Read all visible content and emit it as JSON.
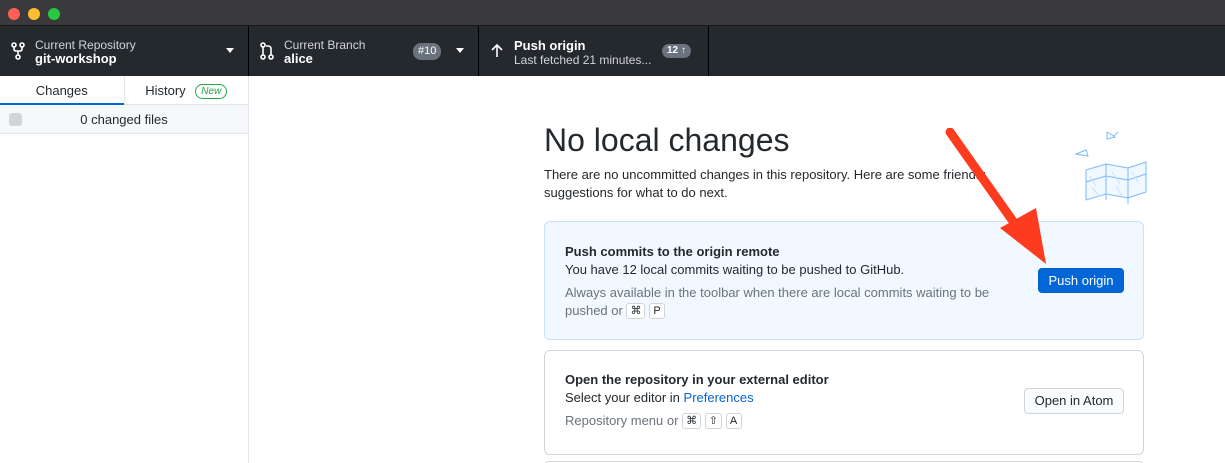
{
  "toolbar": {
    "repository": {
      "label": "Current Repository",
      "value": "git-workshop"
    },
    "branch": {
      "label": "Current Branch",
      "value": "alice",
      "pr_badge": "#10"
    },
    "push": {
      "label": "Push origin",
      "sublabel": "Last fetched 21 minutes...",
      "badge_count": "12",
      "badge_arrow": "↑"
    }
  },
  "sidebar": {
    "tabs": [
      {
        "label": "Changes",
        "active": true
      },
      {
        "label": "History",
        "badge": "New"
      }
    ],
    "changed_files": "0 changed files"
  },
  "main": {
    "title": "No local changes",
    "description": "There are no uncommitted changes in this repository. Here are some friendly suggestions for what to do next.",
    "push_card": {
      "title": "Push commits to the origin remote",
      "text": "You have 12 local commits waiting to be pushed to GitHub.",
      "hint": "Always available in the toolbar when there are local commits waiting to be pushed or",
      "shortcut": [
        "⌘",
        "P"
      ],
      "button": "Push origin"
    },
    "editor_card": {
      "title": "Open the repository in your external editor",
      "text_prefix": "Select your editor in",
      "link": "Preferences",
      "hint": "Repository menu or",
      "shortcut": [
        "⌘",
        "⇧",
        "A"
      ],
      "button": "Open in Atom"
    }
  },
  "colors": {
    "accent": "#0366d6",
    "toolbar_bg": "#24292e",
    "annotation_arrow": "#ff3b1f",
    "new_badge": "#28a745"
  },
  "icons": {
    "repository": "repo-fork-icon",
    "branch": "git-branch-icon",
    "push": "arrow-up-icon"
  }
}
